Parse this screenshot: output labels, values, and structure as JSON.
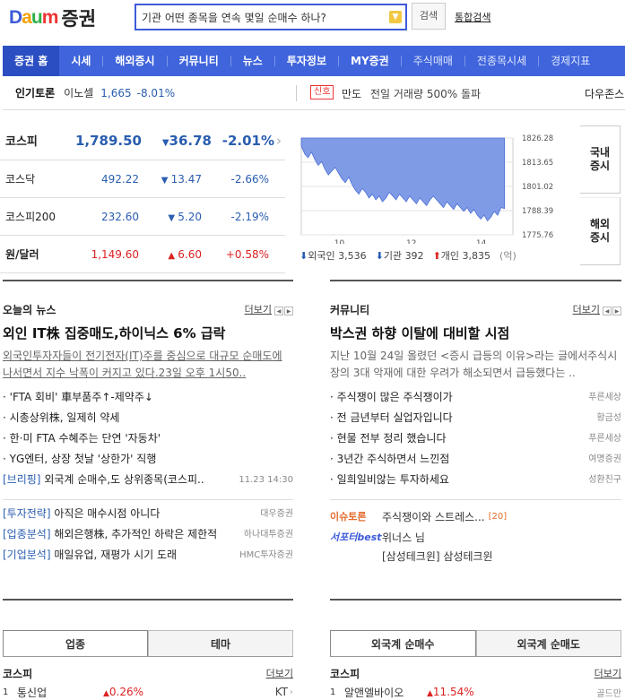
{
  "header": {
    "logo_brand": "Daum",
    "logo_service": "증권",
    "search_value": "기관 어떤 종목을 연속 몇일 순매수 하나?",
    "search_button": "검색",
    "integrated_search": "통합검색"
  },
  "nav": {
    "items": [
      "증권 홈",
      "시세",
      "해외증시",
      "커뮤니티",
      "뉴스",
      "투자정보",
      "MY증권",
      "주식매매",
      "전종목시세",
      "경제지표"
    ]
  },
  "ticker": {
    "label": "인기토론",
    "stock_name": "이노셀",
    "stock_value": "1,665",
    "stock_pct": "-8.01%",
    "badge": "신호",
    "signal_name": "만도",
    "signal_text": "전일 거래량 500% 돌파",
    "right_text": "다우존스"
  },
  "indices": [
    {
      "name": "코스피",
      "value": "1,789.50",
      "change": "36.78",
      "pct": "-2.01%"
    },
    {
      "name": "코스닥",
      "value": "492.22",
      "change": "13.47",
      "pct": "-2.66%"
    },
    {
      "name": "코스피200",
      "value": "232.60",
      "change": "5.20",
      "pct": "-2.19%"
    },
    {
      "name": "원/달러",
      "value": "1,149.60",
      "change": "6.60",
      "pct": "+0.58%"
    }
  ],
  "side_tabs": {
    "domestic": "국내\n증시",
    "overseas": "해외\n증시"
  },
  "chart_data": {
    "type": "area",
    "x_ticks": [
      "10",
      "12",
      "14"
    ],
    "y_ticks": [
      1826.28,
      1813.65,
      1801.02,
      1788.39,
      1775.76
    ],
    "ylim": [
      1775.76,
      1826.28
    ],
    "values": [
      1822,
      1818,
      1816,
      1819,
      1815,
      1812,
      1814,
      1810,
      1807,
      1809,
      1811,
      1808,
      1805,
      1803,
      1806,
      1802,
      1799,
      1797,
      1800,
      1798,
      1795,
      1797,
      1794,
      1796,
      1793,
      1795,
      1798,
      1796,
      1794,
      1797,
      1795,
      1793,
      1796,
      1794,
      1792,
      1795,
      1793,
      1791,
      1794,
      1796,
      1794,
      1792,
      1790,
      1793,
      1791,
      1789,
      1792,
      1790,
      1788,
      1790,
      1787,
      1789,
      1786,
      1784,
      1786,
      1783,
      1785,
      1788,
      1786,
      1790,
      1789.5
    ],
    "color": "#7f9be6"
  },
  "flow": {
    "foreign_label": "외국인",
    "foreign_value": "3,536",
    "inst_label": "기관",
    "inst_value": "392",
    "indiv_label": "개인",
    "indiv_value": "3,835",
    "unit": "(억)"
  },
  "news": {
    "title": "오늘의 뉴스",
    "more": "더보기",
    "headline": "외인 IT株 집중매도,하이닉스 6% 급락",
    "summary": "외국인투자자들이 전기전자(IT)주를 중심으로 대규모 순매도에 나서면서 지수 낙폭이 커지고 있다.23일 오후 1시50..",
    "items": [
      "'FTA 회비' 車부품주↑-제약주↓",
      "시총상위株, 일제히 약세",
      "한·미 FTA 수혜주는 단연 '자동차'",
      "YG엔터, 상장 첫날 '상한가' 직행"
    ],
    "briefing_tag": "[브리핑]",
    "briefing_text": "외국계 순매수,도 상위종목(코스피..",
    "briefing_time": "11.23 14:30",
    "reports": [
      {
        "tag": "[투자전략]",
        "text": "아직은 매수시점 아니다",
        "src": "대우증권"
      },
      {
        "tag": "[업종분석]",
        "text": "해외은행株, 추가적인 하락은 제한적",
        "src": "하나대투증권"
      },
      {
        "tag": "[기업분석]",
        "text": "매일유업, 재평가 시기 도래",
        "src": "HMC투자증권"
      }
    ]
  },
  "community": {
    "title": "커뮤니티",
    "more": "더보기",
    "headline": "박스권 하향 이탈에 대비할 시점",
    "summary": "지난 10월 24일 올렸던 <증시 급등의 이유>라는 글에서주식시장의 3대 악재에 대한 우려가 해소되면서 급등했다는 ..",
    "items": [
      {
        "text": "주식쟁이 많은 주식쟁이가",
        "src": "푸른세상"
      },
      {
        "text": "전 금년부터 실업자입니다",
        "src": "황금성"
      },
      {
        "text": "현물 전부 정리 했습니다",
        "src": "푸른세상"
      },
      {
        "text": "3년간 주식하면서 느낀점",
        "src": "여명증권"
      },
      {
        "text": "일희일비않는 투자하세요",
        "src": "성환친구"
      }
    ],
    "issue_label": "이슈토론",
    "issue_text": "주식쟁이와 스트레스...",
    "issue_count": "[20]",
    "supporter_label": "서포터best",
    "supporter_name": "위너스 님",
    "supporter_company": "[삼성테크윈] 삼성테크윈"
  },
  "bottom_left": {
    "tab1": "업종",
    "tab2": "테마",
    "market": "코스피",
    "more": "더보기",
    "row_rank": "1",
    "row_name": "통신업",
    "row_pct": "0.26%",
    "row_stock": "KT"
  },
  "bottom_right": {
    "tab1": "외국계 순매수",
    "tab2": "외국계 순매도",
    "market": "코스피",
    "more": "더보기",
    "row_rank": "1",
    "row_name": "알앤엘바이오",
    "row_pct": "11.54%",
    "row_src": "골드만"
  }
}
